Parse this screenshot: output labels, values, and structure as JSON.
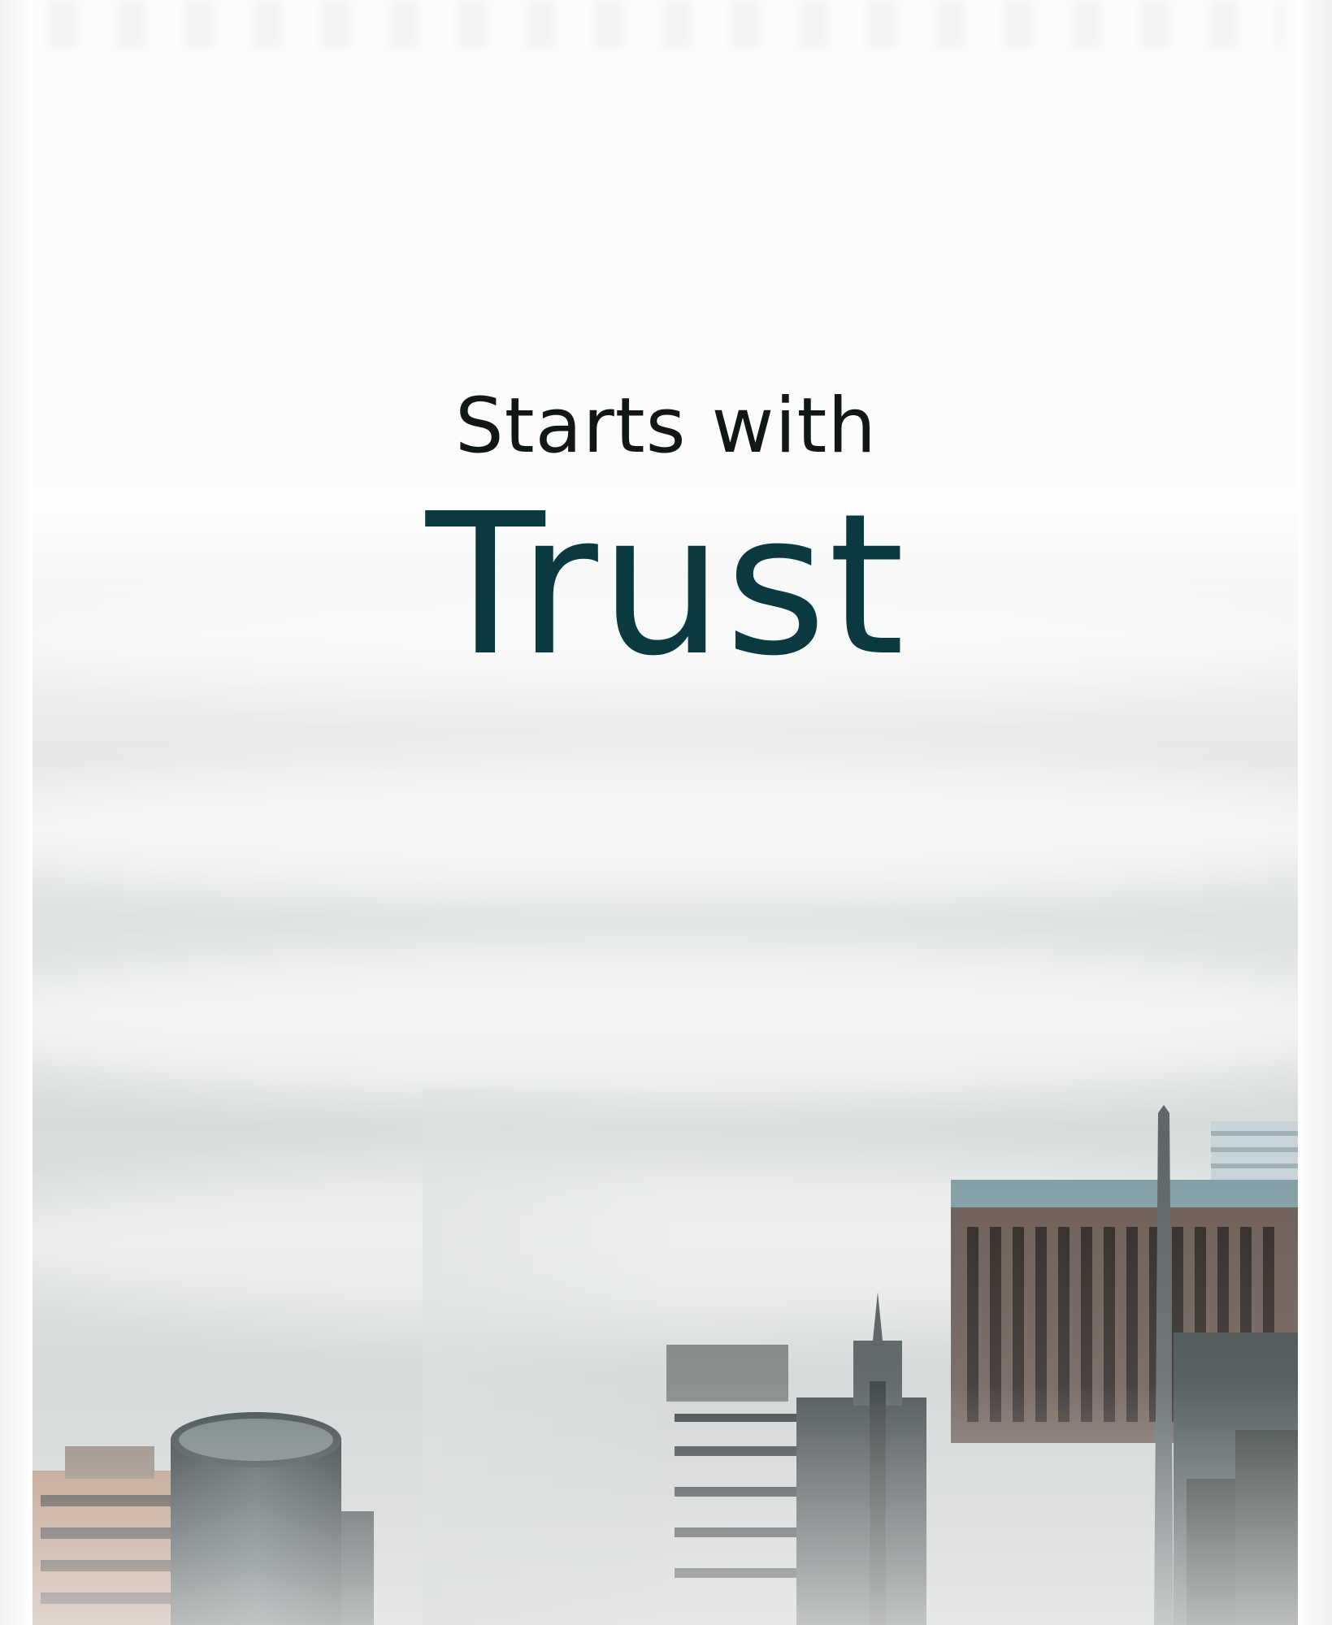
{
  "hero": {
    "subtitle": "Starts with",
    "title": "Trust"
  },
  "colors": {
    "title": "#0a3a40",
    "subtitle": "#111617",
    "background": "#fcfcfc"
  },
  "image": {
    "subject": "city skyline emerging from fog"
  }
}
